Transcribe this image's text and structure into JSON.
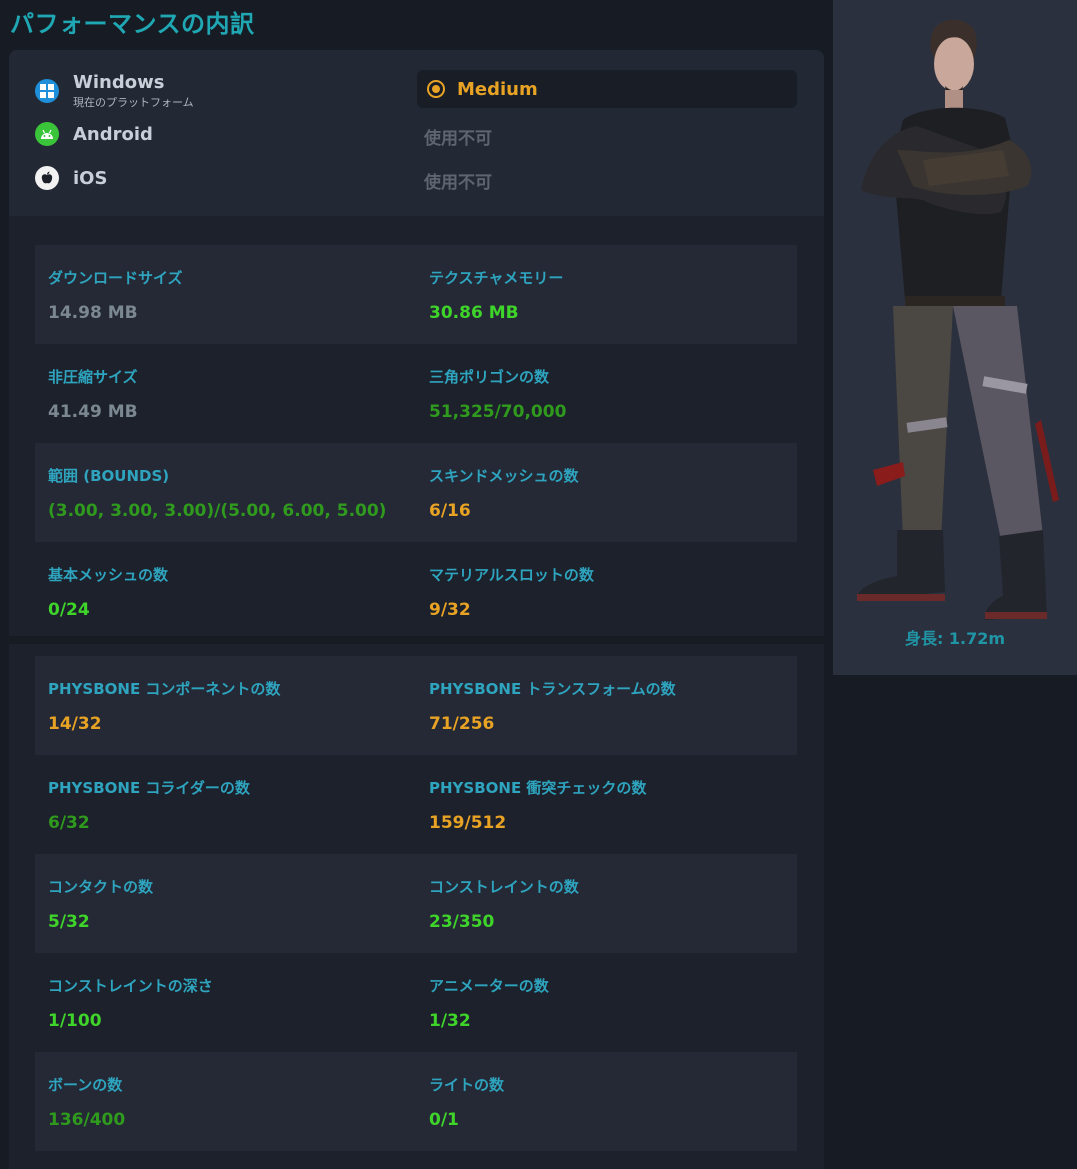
{
  "title": "パフォーマンスの内訳",
  "platforms": [
    {
      "name": "Windows",
      "sub": "現在のプラットフォーム",
      "icon": "windows-icon",
      "rating": "Medium",
      "rating_color": "#e8a324"
    },
    {
      "name": "Android",
      "sub": "",
      "icon": "android-icon",
      "rating": "使用不可"
    },
    {
      "name": "iOS",
      "sub": "",
      "icon": "apple-icon",
      "rating": "使用不可"
    }
  ],
  "stats": [
    {
      "label": "ダウンロードサイズ",
      "value": "14.98 MB",
      "color": "#7b8891"
    },
    {
      "label": "テクスチャメモリー",
      "value": "30.86 MB",
      "color": "#3fd42a"
    },
    {
      "label": "非圧縮サイズ",
      "value": "41.49 MB",
      "color": "#7b8891"
    },
    {
      "label": "三角ポリゴンの数",
      "value": "51,325/70,000",
      "color": "#2f9a1d"
    },
    {
      "label": "範囲 (BOUNDS)",
      "value": "(3.00, 3.00, 3.00)/(5.00, 6.00, 5.00)",
      "color": "#2f9a1d"
    },
    {
      "label": "スキンドメッシュの数",
      "value": "6/16",
      "color": "#e8a324"
    },
    {
      "label": "基本メッシュの数",
      "value": "0/24",
      "color": "#3fd42a"
    },
    {
      "label": "マテリアルスロットの数",
      "value": "9/32",
      "color": "#e8a324"
    }
  ],
  "stats2": [
    {
      "label": "PHYSBONE コンポーネントの数",
      "value": "14/32",
      "color": "#e8a324"
    },
    {
      "label": "PHYSBONE トランスフォームの数",
      "value": "71/256",
      "color": "#e8a324"
    },
    {
      "label": "PHYSBONE コライダーの数",
      "value": "6/32",
      "color": "#2f9a1d"
    },
    {
      "label": "PHYSBONE 衝突チェックの数",
      "value": "159/512",
      "color": "#e8a324"
    },
    {
      "label": "コンタクトの数",
      "value": "5/32",
      "color": "#3fd42a"
    },
    {
      "label": "コンストレイントの数",
      "value": "23/350",
      "color": "#3fd42a"
    },
    {
      "label": "コンストレイントの深さ",
      "value": "1/100",
      "color": "#3fd42a"
    },
    {
      "label": "アニメーターの数",
      "value": "1/32",
      "color": "#3fd42a"
    },
    {
      "label": "ボーンの数",
      "value": "136/400",
      "color": "#2f9a1d"
    },
    {
      "label": "ライトの数",
      "value": "0/1",
      "color": "#3fd42a"
    }
  ],
  "avatar": {
    "height_label": "身長: 1.72m"
  }
}
